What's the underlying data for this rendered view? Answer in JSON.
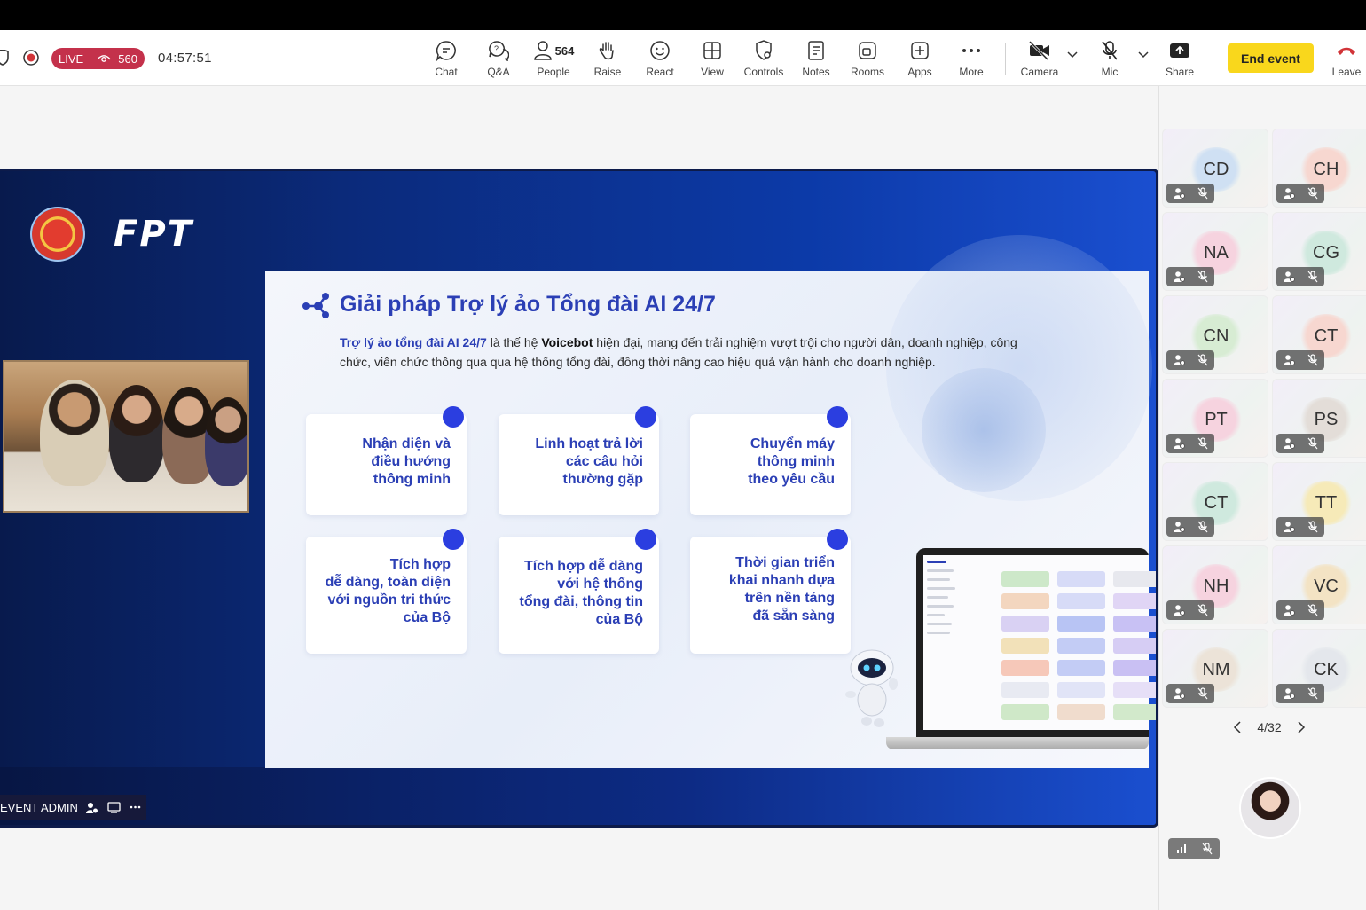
{
  "meeting": {
    "live_label": "LIVE",
    "viewer_count": "560",
    "elapsed_time": "04:57:51"
  },
  "toolbar": {
    "chat": "Chat",
    "qa": "Q&A",
    "people": "People",
    "people_count": "564",
    "raise": "Raise",
    "react": "React",
    "view": "View",
    "controls": "Controls",
    "notes": "Notes",
    "rooms": "Rooms",
    "apps": "Apps",
    "more": "More",
    "camera": "Camera",
    "mic": "Mic",
    "share": "Share",
    "end_event": "End event",
    "leave": "Leave"
  },
  "stage": {
    "logo_text": "FPT",
    "slide_title": "Giải pháp Trợ lý ảo Tổng đài AI 24/7",
    "slide_desc_highlight": "Trợ lý ảo tổng đài AI 24/7",
    "slide_desc_part1": " là thế hệ ",
    "slide_desc_bold": "Voicebot",
    "slide_desc_part2": " hiện đại, mang đến trải nghiệm vượt trội cho người dân, doanh nghiệp, công chức, viên chức thông qua qua hệ thống tổng đài, đồng thời nâng cao hiệu quả vận hành cho doanh nghiệp.",
    "cards": [
      "Nhận diện và\nđiều hướng\nthông minh",
      "Linh hoạt trả lời\ncác câu hỏi\nthường gặp",
      "Chuyển máy\nthông minh\ntheo yêu cầu",
      "Tích hợp\ndễ dàng, toàn diện\nvới nguồn tri thức\ncủa Bộ",
      "Tích hợp dễ dàng\nvới hệ thống\ntổng đài, thông tin\ncủa Bộ",
      "Thời gian triển\nkhai nhanh dựa\ntrên nền tảng\nđã sẵn sàng"
    ],
    "presenter_label": "EVENT ADMIN"
  },
  "participants": [
    {
      "initials": "CD",
      "color": "#cfe0f3"
    },
    {
      "initials": "CH",
      "color": "#f7d7d0"
    },
    {
      "initials": "NA",
      "color": "#f6d3df"
    },
    {
      "initials": "CG",
      "color": "#cfe9de"
    },
    {
      "initials": "CN",
      "color": "#d7ecd3"
    },
    {
      "initials": "CT",
      "color": "#f7d7d0"
    },
    {
      "initials": "PT",
      "color": "#f6d3df"
    },
    {
      "initials": "PS",
      "color": "#e3ddd8"
    },
    {
      "initials": "CT",
      "color": "#cfe9de"
    },
    {
      "initials": "TT",
      "color": "#f6eab8"
    },
    {
      "initials": "NH",
      "color": "#f6d3df"
    },
    {
      "initials": "VC",
      "color": "#f3e3c4"
    },
    {
      "initials": "NM",
      "color": "#ece3d8"
    },
    {
      "initials": "CK",
      "color": "#e4e7ec"
    }
  ],
  "pager": {
    "label": "4/32"
  }
}
